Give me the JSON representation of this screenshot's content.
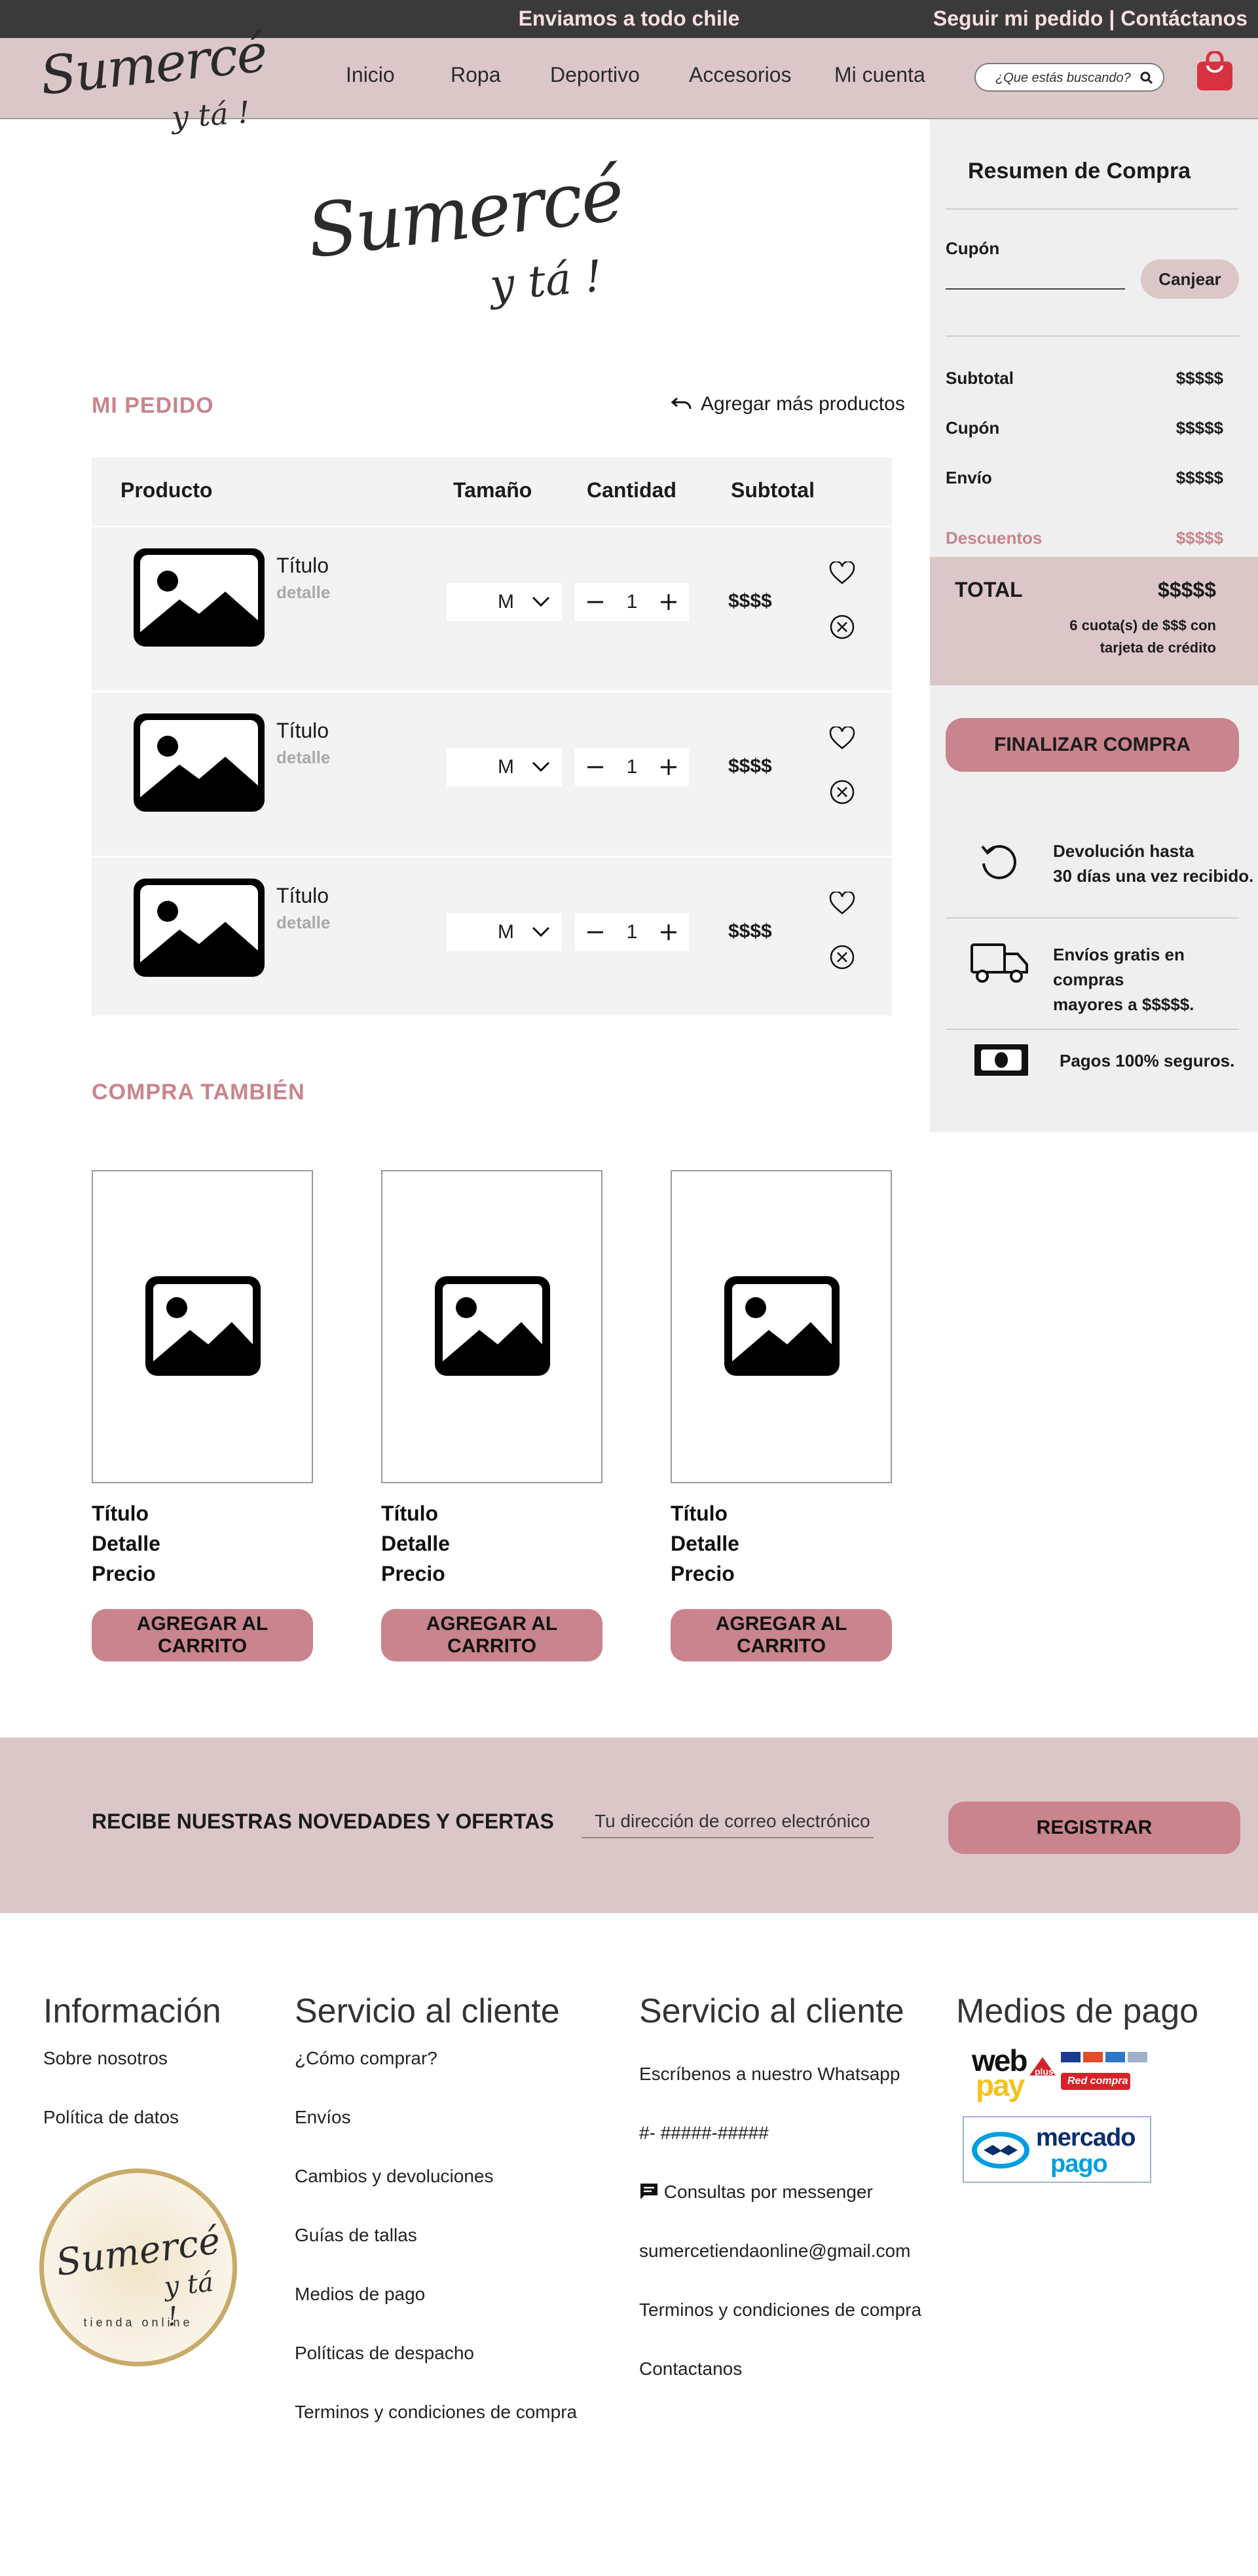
{
  "topbar": {
    "shipping": "Enviamos a todo chile",
    "links": "Seguir mi pedido | Contáctanos"
  },
  "brand": {
    "name": "Sumercé",
    "tagline": "y tá !",
    "seal_text": "tienda online"
  },
  "nav": {
    "items": [
      "Inicio",
      "Ropa",
      "Deportivo",
      "Accesorios",
      "Mi cuenta"
    ],
    "search_placeholder": "¿Que estás buscando?"
  },
  "order": {
    "title": "MI PEDIDO",
    "add_more": "Agregar más productos",
    "headers": {
      "product": "Producto",
      "size": "Tamaño",
      "quantity": "Cantidad",
      "subtotal": "Subtotal"
    },
    "items": [
      {
        "title": "Título",
        "detail": "detalle",
        "size": "M",
        "qty": "1",
        "subtotal": "$$$$"
      },
      {
        "title": "Título",
        "detail": "detalle",
        "size": "M",
        "qty": "1",
        "subtotal": "$$$$"
      },
      {
        "title": "Título",
        "detail": "detalle",
        "size": "M",
        "qty": "1",
        "subtotal": "$$$$"
      }
    ]
  },
  "summary": {
    "title": "Resumen de Compra",
    "coupon_label": "Cupón",
    "coupon_button": "Canjear",
    "rows": [
      {
        "label": "Subtotal",
        "value": "$$$$$"
      },
      {
        "label": "Cupón",
        "value": "$$$$$"
      },
      {
        "label": "Envío",
        "value": "$$$$$"
      }
    ],
    "discount": {
      "label": "Descuentos",
      "value": "$$$$$"
    },
    "total_label": "TOTAL",
    "total_value": "$$$$$",
    "installments_1": "6 cuota(s) de $$$ con",
    "installments_2": "tarjeta de crédito",
    "checkout_button": "FINALIZAR COMPRA",
    "benefits": [
      {
        "icon": "return-icon",
        "line1": "Devolución hasta",
        "line2": "30 días una vez recibido."
      },
      {
        "icon": "truck-icon",
        "line1": "Envíos gratis en compras",
        "line2": "mayores a $$$$$."
      },
      {
        "icon": "money-icon",
        "line1": "Pagos 100% seguros.",
        "line2": ""
      }
    ]
  },
  "also_buy": {
    "title": "COMPRA TAMBIÉN",
    "products": [
      {
        "title": "Título",
        "detail": "Detalle",
        "price": "Precio",
        "button": "AGREGAR AL CARRITO"
      },
      {
        "title": "Título",
        "detail": "Detalle",
        "price": "Precio",
        "button": "AGREGAR AL CARRITO"
      },
      {
        "title": "Título",
        "detail": "Detalle",
        "price": "Precio",
        "button": "AGREGAR AL CARRITO"
      }
    ]
  },
  "newsletter": {
    "title": "RECIBE NUESTRAS NOVEDADES Y OFERTAS",
    "placeholder": "Tu dirección de correo electrónico",
    "button": "REGISTRAR"
  },
  "footer": {
    "info_title": "Información",
    "info_links": [
      "Sobre nosotros",
      "Política de datos"
    ],
    "service_title": "Servicio al cliente",
    "service_links": [
      "¿Cómo comprar?",
      "Envíos",
      "Cambios y devoluciones",
      "Guías de tallas",
      "Medios de pago",
      "Políticas de despacho",
      "Terminos y condiciones de compra"
    ],
    "contact_title": "Servicio al cliente",
    "contact_links": [
      "Escríbenos a nuestro Whatsapp",
      "#- #####-#####",
      "Consultas por messenger",
      "sumercetiendaonline@gmail.com",
      "Terminos y condiciones de compra",
      "Contactanos"
    ],
    "payment_title": "Medios de pago",
    "webpay": {
      "web": "web",
      "pay": "pay",
      "plus": "plus",
      "redcompra": "Red compra"
    },
    "mercadopago": {
      "line1": "mercado",
      "line2": "pago"
    }
  },
  "colors": {
    "accent": "#c9848d",
    "header_bg": "#dcc7c8",
    "topbar_bg": "#3a3a3a",
    "panel_bg": "#f3f3f3"
  }
}
